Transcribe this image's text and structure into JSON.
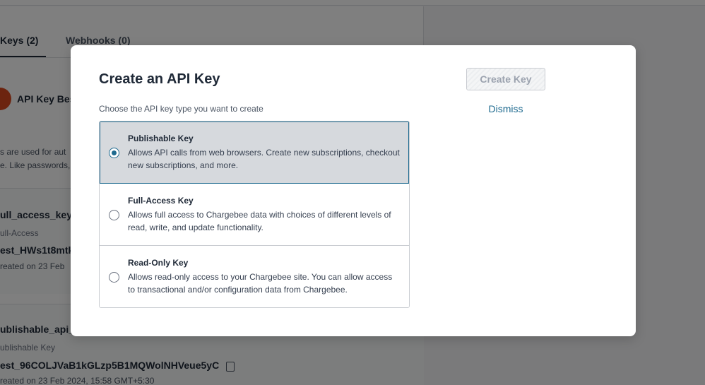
{
  "background": {
    "tabs": [
      {
        "label": "Keys (2)"
      },
      {
        "label": "Webhooks (0)"
      }
    ],
    "best_practices_label": "API Key Bes",
    "description_line1": "s are used for aut",
    "description_line2": "e. Like passwords,",
    "keys": [
      {
        "name": "ull_access_key_",
        "type": "ull-Access",
        "value": "est_HWs1t8mtk",
        "created": "reated on 23 Feb"
      },
      {
        "name": "ublishable_api_",
        "type": "ublishable Key",
        "value": "est_96COLJVaB1kGLzp5B1MQWolNHVeue5yC",
        "created": "reated on 23 Feb 2024, 15:58 GMT+5:30"
      }
    ]
  },
  "modal": {
    "title": "Create an API Key",
    "subtitle": "Choose the API key type you want to create",
    "create_button": "Create Key",
    "dismiss": "Dismiss",
    "options": [
      {
        "title": "Publishable Key",
        "description": "Allows API calls from web browsers. Create new subscriptions, checkout new subscriptions, and more.",
        "selected": true
      },
      {
        "title": "Full-Access Key",
        "description": "Allows full access to Chargebee data with choices of different levels of read, write, and update functionality.",
        "selected": false
      },
      {
        "title": "Read-Only Key",
        "description": "Allows read-only access to your Chargebee site. You can allow access to transactional and/or configuration data from Chargebee.",
        "selected": false
      }
    ]
  },
  "colors": {
    "accent": "#1e6a8f",
    "selected_bg": "#d6d9dd",
    "overlay": "rgba(0,0,0,0.5)"
  },
  "icons": {
    "copy": "copy-icon",
    "radio_selected": "radio-selected-icon",
    "radio_unselected": "radio-unselected-icon"
  }
}
